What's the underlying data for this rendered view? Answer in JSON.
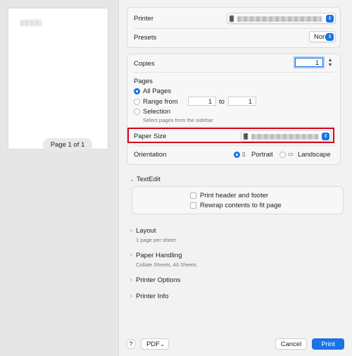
{
  "preview": {
    "page_indicator": "Page 1 of 1"
  },
  "printer": {
    "label": "Printer"
  },
  "presets": {
    "label": "Presets",
    "value": "None"
  },
  "copies": {
    "label": "Copies",
    "value": "1"
  },
  "pages": {
    "label": "Pages",
    "all_label": "All Pages",
    "range_label": "Range from",
    "range_from": "1",
    "range_to_label": "to",
    "range_to": "1",
    "selection_label": "Selection",
    "selection_hint": "Select pages from the sidebar",
    "selected": "all"
  },
  "paper_size": {
    "label": "Paper Size"
  },
  "orientation": {
    "label": "Orientation",
    "portrait_label": "Portrait",
    "landscape_label": "Landscape",
    "selected": "portrait"
  },
  "textedit": {
    "label": "TextEdit",
    "print_header_label": "Print header and footer",
    "rewrap_label": "Rewrap contents to fit page"
  },
  "sections": [
    {
      "label": "Layout",
      "sub": "1 page per sheet"
    },
    {
      "label": "Paper Handling",
      "sub": "Collate Sheets, All Sheets"
    },
    {
      "label": "Printer Options",
      "sub": ""
    },
    {
      "label": "Printer Info",
      "sub": ""
    }
  ],
  "footer": {
    "help_label": "?",
    "pdf_label": "PDF",
    "cancel_label": "Cancel",
    "print_label": "Print"
  },
  "colors": {
    "accent": "#1a73e8",
    "highlight": "#d8001a"
  },
  "icons": [
    "chevron-down-icon",
    "chevron-right-icon",
    "updown-arrows-icon",
    "portrait-icon",
    "landscape-icon"
  ]
}
